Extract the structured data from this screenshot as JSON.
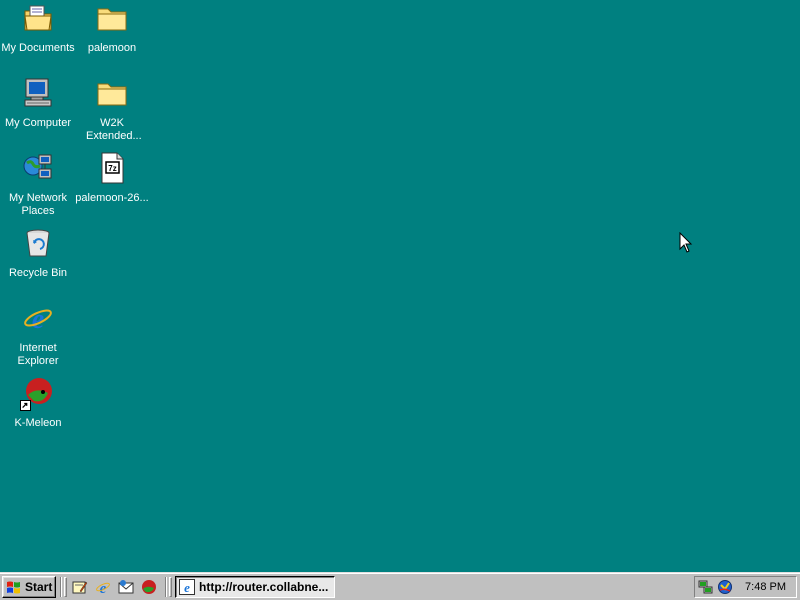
{
  "desktop": {
    "background_color": "#008080",
    "icons": [
      {
        "label": "My Documents",
        "icon": "my-documents-icon"
      },
      {
        "label": "palemoon",
        "icon": "folder-icon"
      },
      {
        "label": "My Computer",
        "icon": "my-computer-icon"
      },
      {
        "label": "W2K Extended...",
        "icon": "folder-icon"
      },
      {
        "label": "My Network Places",
        "icon": "network-places-icon"
      },
      {
        "label": "palemoon-26...",
        "icon": "7z-archive-icon"
      },
      {
        "label": "Recycle Bin",
        "icon": "recycle-bin-icon"
      },
      {
        "label": "Internet Explorer",
        "icon": "internet-explorer-icon"
      },
      {
        "label": "K-Meleon",
        "icon": "k-meleon-icon"
      }
    ]
  },
  "taskbar": {
    "start_label": "Start",
    "quick_launch": [
      "show-desktop-icon",
      "internet-explorer-icon",
      "outlook-express-icon",
      "k-meleon-icon"
    ],
    "tasks": [
      {
        "label": "http://router.collabne...",
        "icon": "internet-explorer-icon",
        "active": true
      }
    ],
    "tray": {
      "icons": [
        "network-connection-icon",
        "volume-icon"
      ],
      "clock": "7:48 PM"
    }
  }
}
